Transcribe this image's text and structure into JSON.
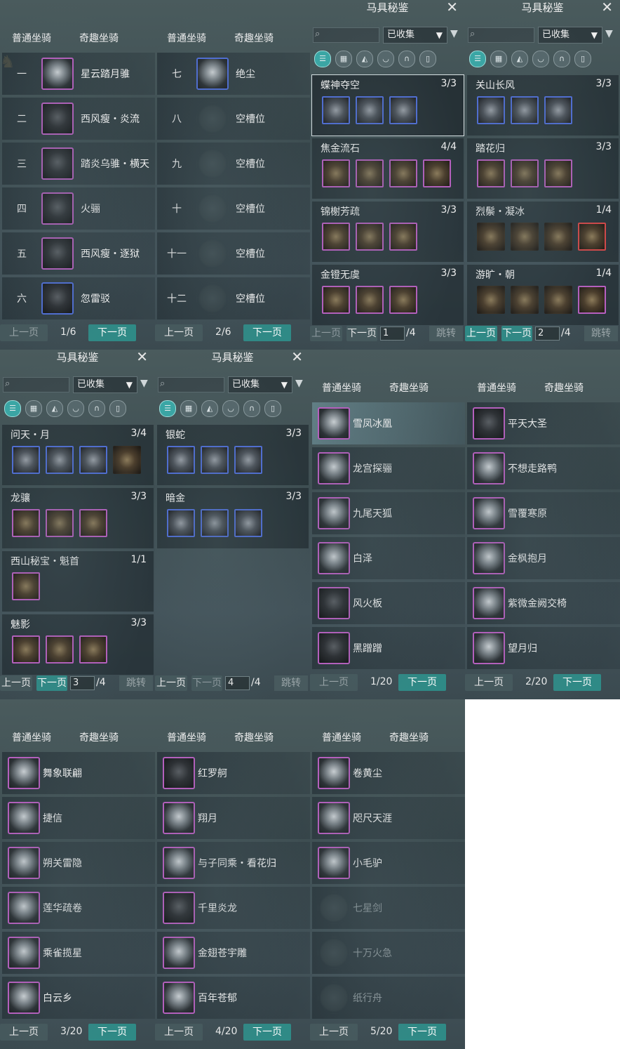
{
  "colors": {
    "accent": "#2f8a86",
    "rare_border": "#b85fc0",
    "epic_border": "#4f6ed8"
  },
  "common": {
    "tab_normal": "普通坐骑",
    "tab_fun": "奇趣坐骑",
    "prev": "上一页",
    "next": "下一页",
    "compendium_title": "马具秘鉴",
    "collected_option": "已收集",
    "jump": "跳转",
    "total_pages": "/4"
  },
  "normal_p1": {
    "page": "1/6",
    "rows": [
      {
        "num": "一",
        "name": "星云踏月骓"
      },
      {
        "num": "二",
        "name": "西风瘦・炎流"
      },
      {
        "num": "三",
        "name": "踏炎乌骓・横天"
      },
      {
        "num": "四",
        "name": "火骊"
      },
      {
        "num": "五",
        "name": "西风瘦・逐狱"
      },
      {
        "num": "六",
        "name": "忽雷驳"
      }
    ]
  },
  "normal_p2": {
    "page": "2/6",
    "rows": [
      {
        "num": "七",
        "name": "绝尘"
      },
      {
        "num": "八",
        "name": "空槽位"
      },
      {
        "num": "九",
        "name": "空槽位"
      },
      {
        "num": "十",
        "name": "空槽位"
      },
      {
        "num": "十一",
        "name": "空槽位"
      },
      {
        "num": "十二",
        "name": "空槽位"
      }
    ]
  },
  "comp1": {
    "page_input": "1",
    "groups": [
      {
        "name": "蝶神夺空",
        "count": "3/3"
      },
      {
        "name": "焦金流石",
        "count": "4/4"
      },
      {
        "name": "锦榭芳疏",
        "count": "3/3"
      },
      {
        "name": "金镫无虞",
        "count": "3/3"
      }
    ]
  },
  "comp2": {
    "page_input": "2",
    "groups": [
      {
        "name": "关山长风",
        "count": "3/3"
      },
      {
        "name": "踏花归",
        "count": "3/3"
      },
      {
        "name": "烈鬃・凝冰",
        "count": "1/4"
      },
      {
        "name": "游旷・朝",
        "count": "1/4"
      }
    ]
  },
  "comp3": {
    "page_input": "3",
    "groups": [
      {
        "name": "问天・月",
        "count": "3/4"
      },
      {
        "name": "龙骧",
        "count": "3/3"
      },
      {
        "name": "西山秘宝・魁首",
        "count": "1/1"
      },
      {
        "name": "魅影",
        "count": "3/3"
      }
    ]
  },
  "comp4": {
    "page_input": "4",
    "groups": [
      {
        "name": "银蛇",
        "count": "3/3"
      },
      {
        "name": "暗金",
        "count": "3/3"
      }
    ]
  },
  "fun_p1": {
    "page": "1/20",
    "rows": [
      "雪凤冰凰",
      "龙宫探骊",
      "九尾天狐",
      "白泽",
      "风火板",
      "黑蹭蹭"
    ]
  },
  "fun_p2": {
    "page": "2/20",
    "rows": [
      "平天大圣",
      "不想走路鸭",
      "雪覆寒原",
      "金枫抱月",
      "紫微金阙交椅",
      "望月归"
    ]
  },
  "fun_p3": {
    "page": "3/20",
    "rows": [
      "舞象联翩",
      "捷信",
      "朔关雷隐",
      "莲华疏卷",
      "乘雀揽星",
      "白云乡"
    ]
  },
  "fun_p4": {
    "page": "4/20",
    "rows": [
      "红罗舸",
      "翔月",
      "与子同乘・看花归",
      "千里炎龙",
      "金翅苍宇雕",
      "百年苍郁"
    ]
  },
  "fun_p5": {
    "page": "5/20",
    "rows": [
      "卷黄尘",
      "咫尺天涯",
      "小毛驴",
      "七星剑",
      "十万火急",
      "纸行舟"
    ]
  }
}
